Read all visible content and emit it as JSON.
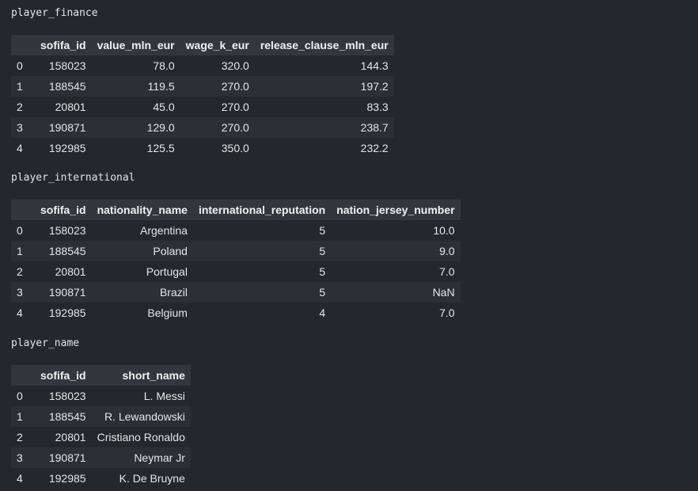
{
  "outputs": [
    {
      "label": "player_finance",
      "columns": [
        "",
        "sofifa_id",
        "value_mln_eur",
        "wage_k_eur",
        "release_clause_mln_eur"
      ],
      "rows": [
        [
          "0",
          "158023",
          "78.0",
          "320.0",
          "144.3"
        ],
        [
          "1",
          "188545",
          "119.5",
          "270.0",
          "197.2"
        ],
        [
          "2",
          "20801",
          "45.0",
          "270.0",
          "83.3"
        ],
        [
          "3",
          "190871",
          "129.0",
          "270.0",
          "238.7"
        ],
        [
          "4",
          "192985",
          "125.5",
          "350.0",
          "232.2"
        ]
      ]
    },
    {
      "label": "player_international",
      "columns": [
        "",
        "sofifa_id",
        "nationality_name",
        "international_reputation",
        "nation_jersey_number"
      ],
      "rows": [
        [
          "0",
          "158023",
          "Argentina",
          "5",
          "10.0"
        ],
        [
          "1",
          "188545",
          "Poland",
          "5",
          "9.0"
        ],
        [
          "2",
          "20801",
          "Portugal",
          "5",
          "7.0"
        ],
        [
          "3",
          "190871",
          "Brazil",
          "5",
          "NaN"
        ],
        [
          "4",
          "192985",
          "Belgium",
          "4",
          "7.0"
        ]
      ]
    },
    {
      "label": "player_name",
      "columns": [
        "",
        "sofifa_id",
        "short_name"
      ],
      "rows": [
        [
          "0",
          "158023",
          "L. Messi"
        ],
        [
          "1",
          "188545",
          "R. Lewandowski"
        ],
        [
          "2",
          "20801",
          "Cristiano Ronaldo"
        ],
        [
          "3",
          "190871",
          "Neymar Jr"
        ],
        [
          "4",
          "192985",
          "K. De Bruyne"
        ]
      ]
    }
  ]
}
